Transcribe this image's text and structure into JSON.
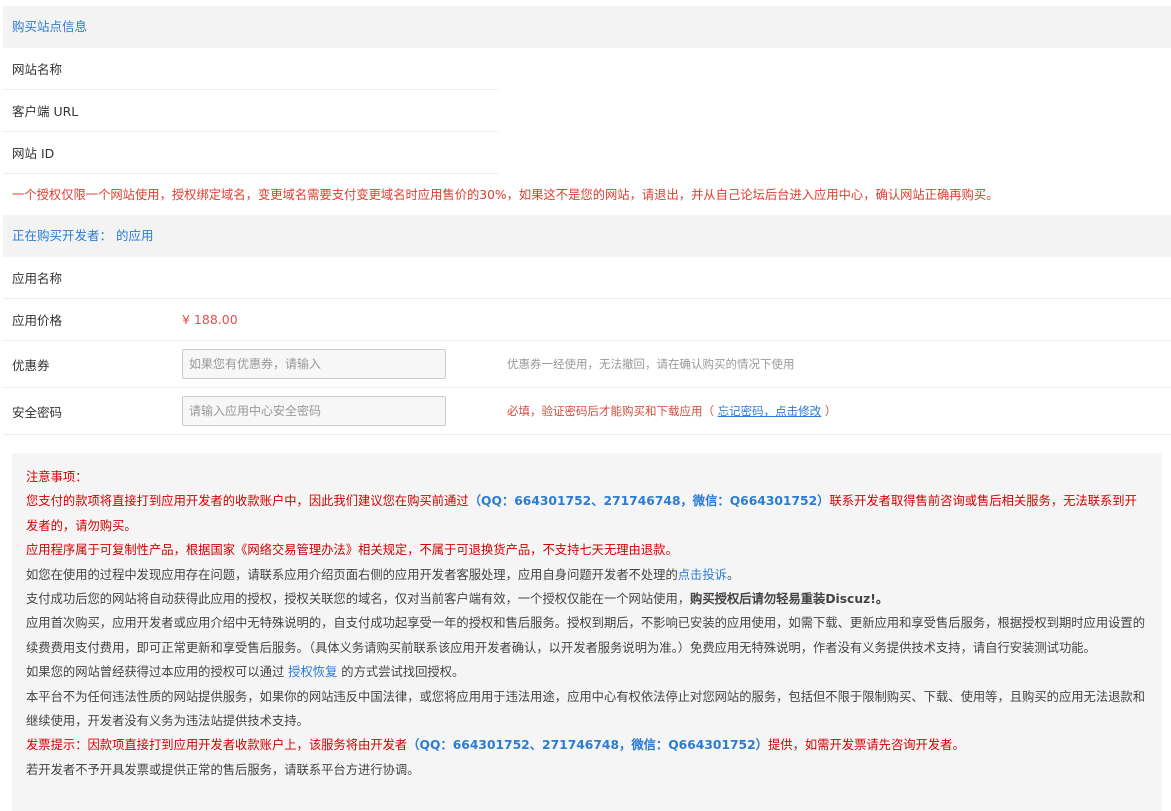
{
  "site_section": {
    "title": "购买站点信息",
    "rows": [
      {
        "label": "网站名称"
      },
      {
        "label": "客户端 URL"
      },
      {
        "label": "网站 ID"
      }
    ],
    "warning": "一个授权仅限一个网站使用，授权绑定域名，变更域名需要支付变更域名时应用售价的30%，如果这不是您的网站，请退出，并从自己论坛后台进入应用中心，确认网站正确再购买。"
  },
  "app_section": {
    "title": "正在购买开发者： 的应用",
    "app_name_label": "应用名称",
    "price_label": "应用价格",
    "price_value": "¥ 188.00",
    "coupon_label": "优惠券",
    "coupon_placeholder": "如果您有优惠券，请输入",
    "coupon_hint": "优惠券一经使用，无法撤回，请在确认购买的情况下使用",
    "password_label": "安全密码",
    "password_placeholder": "请输入应用中心安全密码",
    "password_hint_prefix": "必填，验证密码后才能购买和下载应用（",
    "password_hint_link": "忘记密码，点击修改",
    "password_hint_suffix": "）"
  },
  "notice": {
    "heading": "注意事项：",
    "p1_a": "您支付的款项将直接打到应用开发者的收款账户中，因此我们建议您在购买前通过",
    "p1_contact": "（QQ：664301752、271746748，微信：Q664301752）",
    "p1_b": "联系开发者取得售前咨询或售后相关服务，无法联系到开发者的，请勿购买。",
    "p2": "应用程序属于可复制性产品，根据国家《网络交易管理办法》相关规定，不属于可退换货产品，不支持七天无理由退款。",
    "p3_a": "如您在使用的过程中发现应用存在问题，请联系应用介绍页面右侧的应用开发者客服处理，应用自身问题开发者不处理的",
    "p3_link": "点击投诉",
    "p3_b": "。",
    "p4_a": "支付成功后您的网站将自动获得此应用的授权，授权关联您的域名，仅对当前客户端有效，一个授权仅能在一个网站使用，",
    "p4_bold": "购买授权后请勿轻易重装Discuz!。",
    "p5": "应用首次购买，应用开发者或应用介绍中无特殊说明的，自支付成功起享受一年的授权和售后服务。授权到期后，不影响已安装的应用使用，如需下载、更新应用和享受售后服务，根据授权到期时应用设置的续费费用支付费用，即可正常更新和享受售后服务。（具体义务请购买前联系该应用开发者确认，以开发者服务说明为准。）免费应用无特殊说明，作者没有义务提供技术支持，请自行安装测试功能。",
    "p6_a": "如果您的网站曾经获得过本应用的授权可以通过",
    "p6_link": "授权恢复",
    "p6_b": "的方式尝试找回授权。",
    "p7": "本平台不为任何违法性质的网站提供服务，如果你的网站违反中国法律，或您将应用用于违法用途，应用中心有权依法停止对您网站的服务，包括但不限于限制购买、下载、使用等，且购买的应用无法退款和继续使用，开发者没有义务为违法站提供技术支持。",
    "p8_a": "发票提示：因款项直接打到应用开发者收款账户上，该服务将由开发者",
    "p8_contact": "（QQ：664301752、271746748，微信：Q664301752）",
    "p8_b": "提供，如需开发票请先咨询开发者。",
    "p9": "若开发者不予开具发票或提供正常的售后服务，请联系平台方进行协调。"
  }
}
